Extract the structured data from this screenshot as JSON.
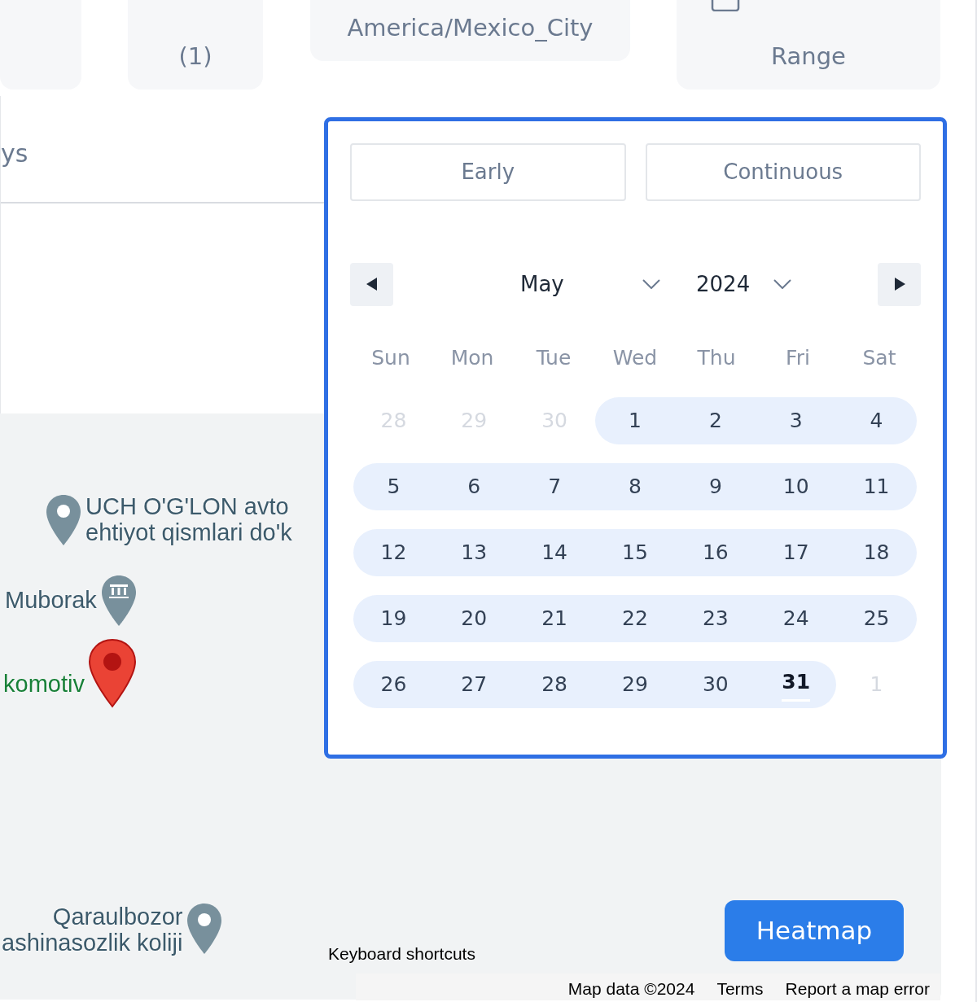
{
  "top_buttons": [
    {
      "kind": "text",
      "label": "(1)"
    },
    {
      "kind": "text",
      "label": "America/Mexico_City"
    },
    {
      "kind": "calendar",
      "label": "Range"
    }
  ],
  "tab": {
    "label": "ys"
  },
  "calendar": {
    "modes": [
      {
        "label": "Early"
      },
      {
        "label": "Continuous"
      }
    ],
    "month": "May",
    "year": "2024",
    "weekdays": [
      "Sun",
      "Mon",
      "Tue",
      "Wed",
      "Thu",
      "Fri",
      "Sat"
    ],
    "weeks": [
      [
        {
          "label": "28",
          "outside": true,
          "in_range": false,
          "today": false
        },
        {
          "label": "29",
          "outside": true,
          "in_range": false,
          "today": false
        },
        {
          "label": "30",
          "outside": true,
          "in_range": false,
          "today": false
        },
        {
          "label": "1",
          "outside": false,
          "in_range": true,
          "today": false
        },
        {
          "label": "2",
          "outside": false,
          "in_range": true,
          "today": false
        },
        {
          "label": "3",
          "outside": false,
          "in_range": true,
          "today": false
        },
        {
          "label": "4",
          "outside": false,
          "in_range": true,
          "today": false
        }
      ],
      [
        {
          "label": "5",
          "outside": false,
          "in_range": true,
          "today": false
        },
        {
          "label": "6",
          "outside": false,
          "in_range": true,
          "today": false
        },
        {
          "label": "7",
          "outside": false,
          "in_range": true,
          "today": false
        },
        {
          "label": "8",
          "outside": false,
          "in_range": true,
          "today": false
        },
        {
          "label": "9",
          "outside": false,
          "in_range": true,
          "today": false
        },
        {
          "label": "10",
          "outside": false,
          "in_range": true,
          "today": false
        },
        {
          "label": "11",
          "outside": false,
          "in_range": true,
          "today": false
        }
      ],
      [
        {
          "label": "12",
          "outside": false,
          "in_range": true,
          "today": false
        },
        {
          "label": "13",
          "outside": false,
          "in_range": true,
          "today": false
        },
        {
          "label": "14",
          "outside": false,
          "in_range": true,
          "today": false
        },
        {
          "label": "15",
          "outside": false,
          "in_range": true,
          "today": false
        },
        {
          "label": "16",
          "outside": false,
          "in_range": true,
          "today": false
        },
        {
          "label": "17",
          "outside": false,
          "in_range": true,
          "today": false
        },
        {
          "label": "18",
          "outside": false,
          "in_range": true,
          "today": false
        }
      ],
      [
        {
          "label": "19",
          "outside": false,
          "in_range": true,
          "today": false
        },
        {
          "label": "20",
          "outside": false,
          "in_range": true,
          "today": false
        },
        {
          "label": "21",
          "outside": false,
          "in_range": true,
          "today": false
        },
        {
          "label": "22",
          "outside": false,
          "in_range": true,
          "today": false
        },
        {
          "label": "23",
          "outside": false,
          "in_range": true,
          "today": false
        },
        {
          "label": "24",
          "outside": false,
          "in_range": true,
          "today": false
        },
        {
          "label": "25",
          "outside": false,
          "in_range": true,
          "today": false
        }
      ],
      [
        {
          "label": "26",
          "outside": false,
          "in_range": true,
          "today": false
        },
        {
          "label": "27",
          "outside": false,
          "in_range": true,
          "today": false
        },
        {
          "label": "28",
          "outside": false,
          "in_range": true,
          "today": false
        },
        {
          "label": "29",
          "outside": false,
          "in_range": true,
          "today": false
        },
        {
          "label": "30",
          "outside": false,
          "in_range": true,
          "today": false
        },
        {
          "label": "31",
          "outside": false,
          "in_range": true,
          "today": true
        },
        {
          "label": "1",
          "outside": true,
          "in_range": false,
          "today": false
        }
      ]
    ]
  },
  "map": {
    "places": [
      {
        "kind": "gray",
        "lines": [
          "UCH O'G'LON avto",
          "ehtiyot qismlari do'k"
        ]
      },
      {
        "kind": "bank",
        "lines": [
          "Muborak"
        ]
      },
      {
        "kind": "red",
        "lines": [
          "komotiv"
        ]
      },
      {
        "kind": "gray_left",
        "lines": [
          "Qaraulbozor",
          "ashinasozlik koliji"
        ]
      }
    ],
    "heatmap_button": "Heatmap",
    "shortcuts": "Keyboard shortcuts",
    "footer": [
      "Map data ©2024",
      "Terms",
      "Report a map error"
    ]
  }
}
